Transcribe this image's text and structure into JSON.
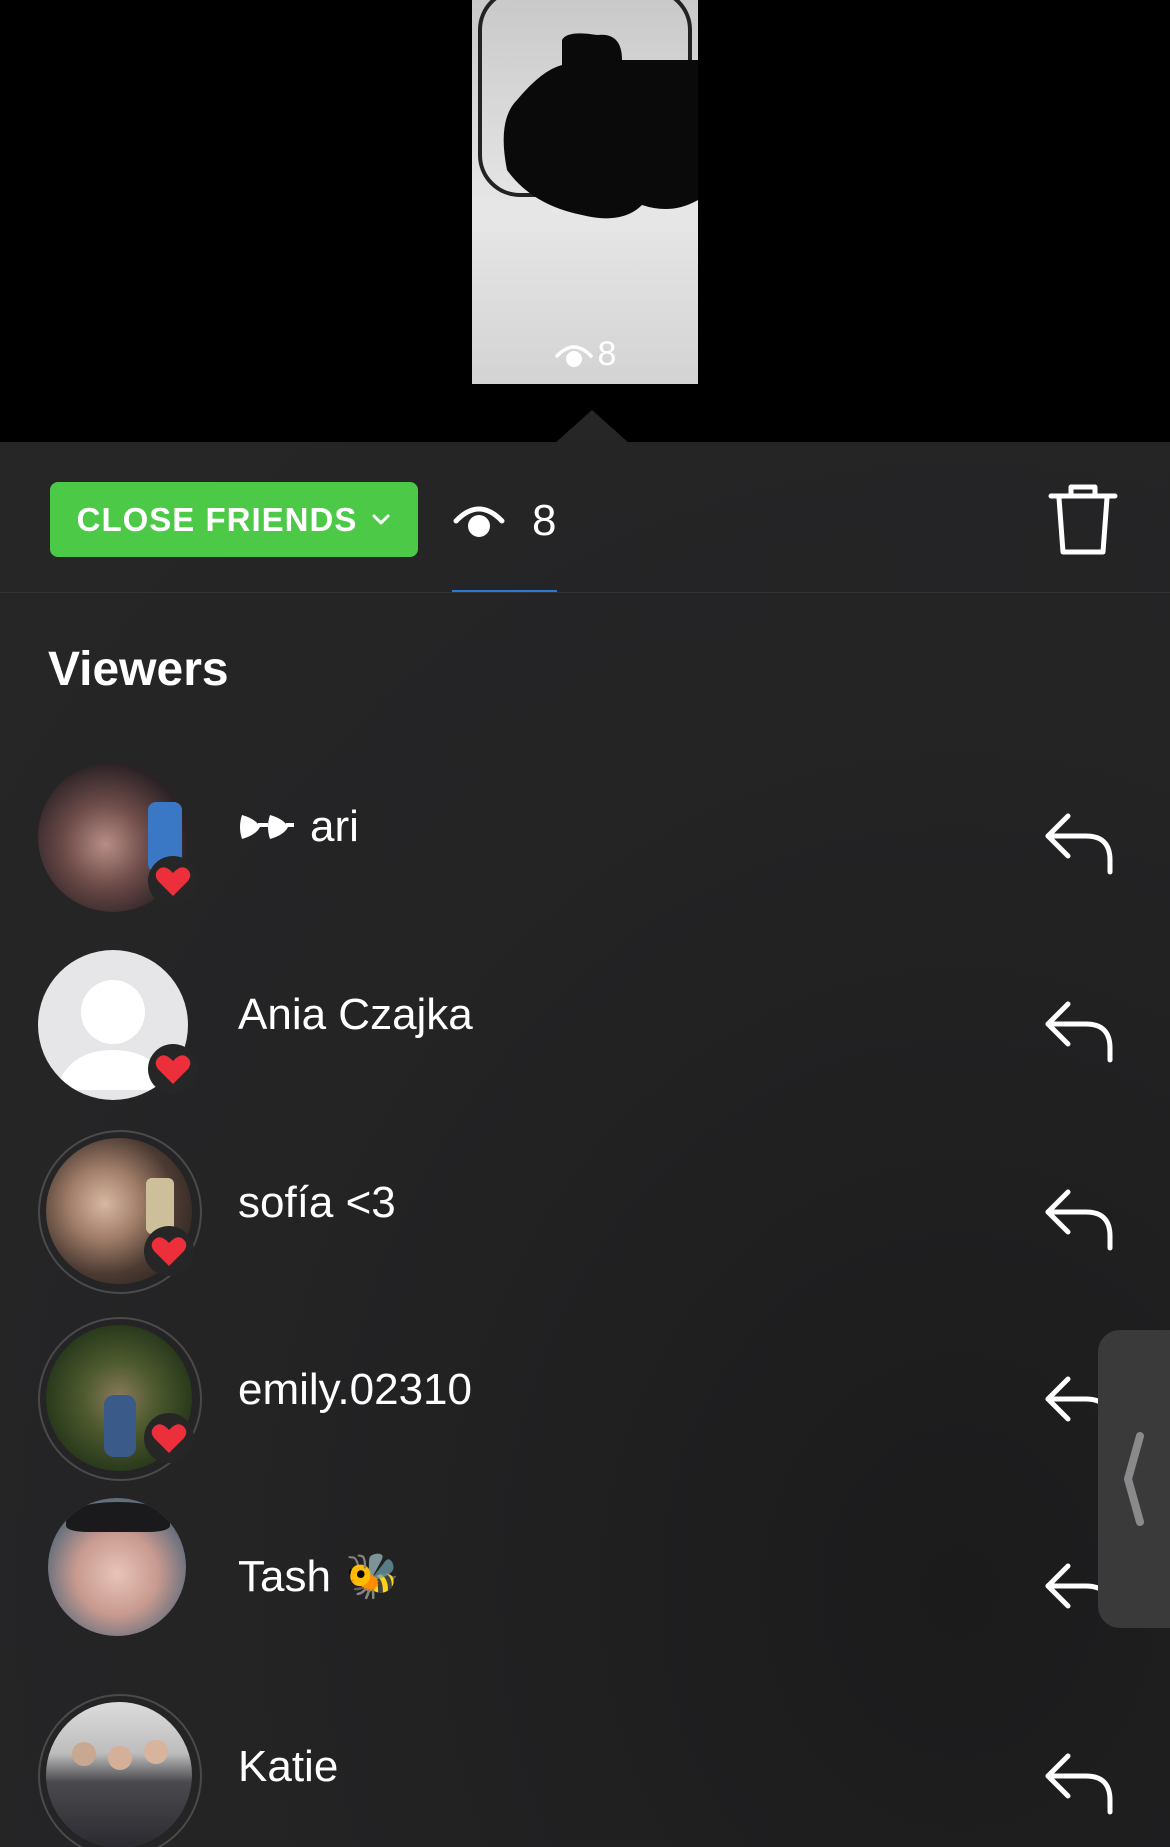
{
  "story_preview": {
    "view_count": "8",
    "eye_icon": "eye-icon"
  },
  "header": {
    "audience_button_label": "CLOSE FRIENDS",
    "views_count": "8",
    "delete_icon": "trash-icon"
  },
  "viewers_section": {
    "title": "Viewers",
    "items": [
      {
        "prefix": "",
        "name": "ari",
        "avatar": "photo",
        "close_friend": true
      },
      {
        "prefix": "",
        "name": "Ania Czajka",
        "avatar": "default",
        "close_friend": true
      },
      {
        "prefix": "",
        "name": "sofía <3",
        "avatar": "photo",
        "close_friend": true
      },
      {
        "prefix": "",
        "name": "emily.02310",
        "avatar": "photo",
        "close_friend": true
      },
      {
        "prefix": "",
        "name": "Tash",
        "suffix_emoji": "🐝",
        "avatar": "photo",
        "close_friend": false
      },
      {
        "prefix": "",
        "name": "Katie",
        "avatar": "photo",
        "close_friend": false
      }
    ]
  },
  "colors": {
    "close_friends_green": "#4dc948",
    "heart_red": "#ed2f3c",
    "tab_underline_blue": "#2d77d6",
    "sheet_bg": "#262627"
  }
}
